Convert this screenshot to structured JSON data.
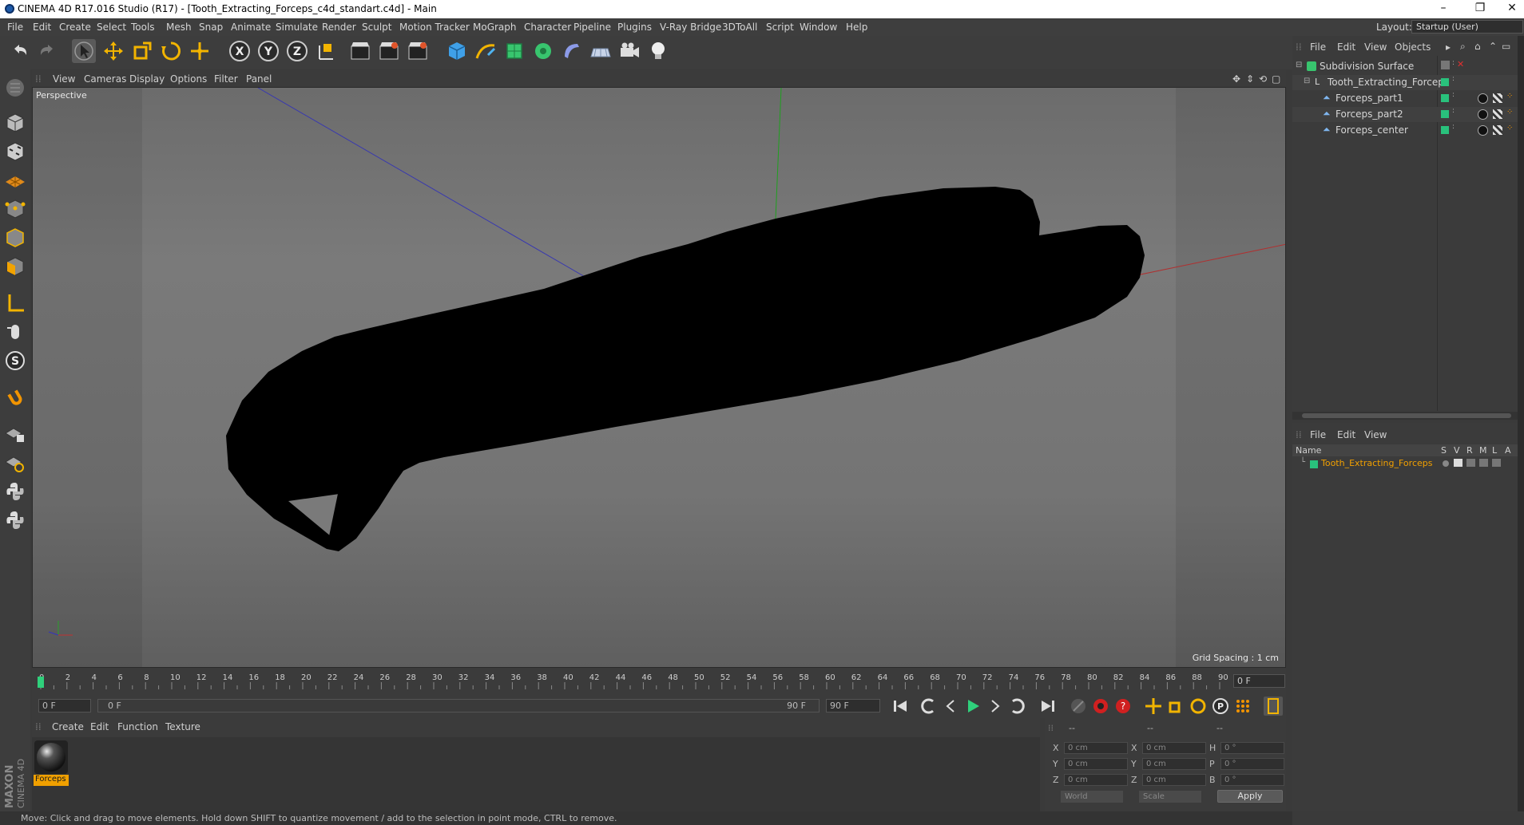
{
  "window": {
    "title": "CINEMA 4D R17.016 Studio (R17) - [Tooth_Extracting_Forceps_c4d_standart.c4d] - Main",
    "min_glyph": "–",
    "restore_glyph": "❐",
    "close_glyph": "✕"
  },
  "menu": [
    "File",
    "Edit",
    "Create",
    "Select",
    "Tools",
    "Mesh",
    "Snap",
    "Animate",
    "Simulate",
    "Render",
    "Sculpt",
    "Motion Tracker",
    "MoGraph",
    "Character",
    "Pipeline",
    "Plugins",
    "V-Ray Bridge",
    "3DToAll",
    "Script",
    "Window",
    "Help"
  ],
  "layout": {
    "label": "Layout:",
    "value": "Startup (User)"
  },
  "viewport": {
    "menu": [
      "View",
      "Cameras",
      "Display",
      "Options",
      "Filter",
      "Panel"
    ],
    "camera_label": "Perspective",
    "grid_spacing": "Grid Spacing : 1 cm",
    "axis_x": "X",
    "axis_y": "Y"
  },
  "timeline": {
    "ticks": [
      "0",
      "2",
      "4",
      "6",
      "8",
      "10",
      "12",
      "14",
      "16",
      "18",
      "20",
      "22",
      "24",
      "26",
      "28",
      "30",
      "32",
      "34",
      "36",
      "38",
      "40",
      "42",
      "44",
      "46",
      "48",
      "50",
      "52",
      "54",
      "56",
      "58",
      "60",
      "62",
      "64",
      "66",
      "68",
      "70",
      "72",
      "74",
      "76",
      "78",
      "80",
      "82",
      "84",
      "86",
      "88",
      "90"
    ],
    "current_frame": "0 F",
    "start_field": "0 F",
    "range_start": "0 F",
    "range_end": "90 F",
    "end_field": "90 F"
  },
  "material_manager": {
    "menu": [
      "Create",
      "Edit",
      "Function",
      "Texture"
    ],
    "material_name": "Forceps"
  },
  "coordinates": {
    "header_dashes": [
      "--",
      "--",
      "--"
    ],
    "rows": [
      {
        "a": "X",
        "av": "0 cm",
        "b": "X",
        "bv": "0 cm",
        "c": "H",
        "cv": "0 °"
      },
      {
        "a": "Y",
        "av": "0 cm",
        "b": "Y",
        "bv": "0 cm",
        "c": "P",
        "cv": "0 °"
      },
      {
        "a": "Z",
        "av": "0 cm",
        "b": "Z",
        "bv": "0 cm",
        "c": "B",
        "cv": "0 °"
      }
    ],
    "mode1": "World",
    "mode2": "Scale",
    "apply": "Apply"
  },
  "status": "Move: Click and drag to move elements. Hold down SHIFT to quantize movement / add to the selection in point mode, CTRL to remove.",
  "object_manager": {
    "menu": [
      "File",
      "Edit",
      "View",
      "Objects"
    ],
    "objects": [
      {
        "name": "Subdivision Surface"
      },
      {
        "name": "Tooth_Extracting_Forceps"
      },
      {
        "name": "Forceps_part1"
      },
      {
        "name": "Forceps_part2"
      },
      {
        "name": "Forceps_center"
      }
    ]
  },
  "layer_manager": {
    "menu": [
      "File",
      "Edit",
      "View"
    ],
    "columns": [
      "Name",
      "S",
      "V",
      "R",
      "M",
      "L",
      "A"
    ],
    "row": "Tooth_Extracting_Forceps"
  },
  "maxon": {
    "brand": "MAXON",
    "product": "CINEMA 4D"
  },
  "colors": {
    "accent_orange": "#f0a000",
    "tag_green": "#29c17c",
    "axis_x": "#c03030",
    "axis_y": "#20a020",
    "axis_z": "#3030c0"
  }
}
